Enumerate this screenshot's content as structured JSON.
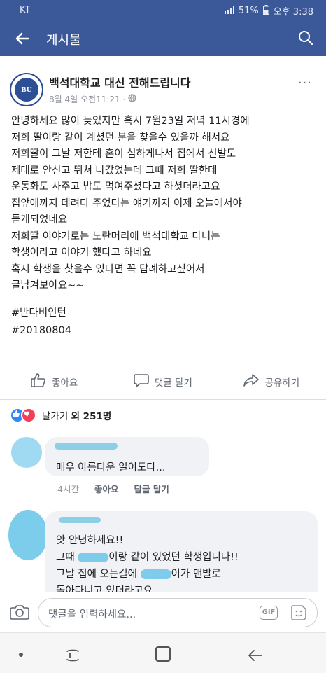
{
  "status_bar": {
    "carrier": "KT",
    "battery": "51%",
    "time": "오후 3:38"
  },
  "app_bar": {
    "title": "게시물"
  },
  "post": {
    "author": "백석대학교 대신 전해드립니다",
    "avatar_text": "BU",
    "timestamp": "8월 4일 오전11:21 ·",
    "body_lines": [
      "안녕하세요 많이 늦었지만 혹시 7월23일 저녁 11시경에",
      "저희 딸이랑 같이 계셨던 분을 찾을수 있을까 해서요",
      "저희딸이 그날 저한테 혼이 심하게나서 집에서 신발도",
      "제대로 안신고 뛰쳐 나갔었는데 그때 저희 딸한테",
      "운동화도 사주고 밥도 먹여주셨다고 하셧더라고요",
      "집앞에까지 데려다 주었다는 얘기까지 이제 오늘에서야",
      "듣게되었네요",
      "저희딸 이야기로는 노란머리에 백석대학교 다니는",
      "학생이라고 이야기 했다고 하네요",
      "혹시 학생을 찾을수 있다면 꼭 답례하고싶어서",
      "글남겨보아요~~"
    ],
    "hashtag1": "#반다비인턴",
    "hashtag2": "#20180804"
  },
  "actions": {
    "like": "좋아요",
    "comment": "댓글 달기",
    "share": "공유하기"
  },
  "reactions": {
    "prefix": "달가기",
    "count_text": "외 251명"
  },
  "comment1": {
    "text": "매우 아름다운 일이도다...",
    "time": "4시간",
    "like": "좋아요",
    "reply": "답글 달기"
  },
  "comment2": {
    "line1": "앗 안녕하세요!!",
    "line2a": "그때",
    "line2b": "이랑 같이 있었던 학생입니다!!",
    "line3a": "그날 집에 오는길에",
    "line3b": "이가 맨발로",
    "line4": "돌아다니고 있더라고요"
  },
  "composer": {
    "placeholder": "댓글을 입력하세요...",
    "gif_label": "GIF"
  },
  "colors": {
    "brand": "#3b5998",
    "like_blue": "#2d88ff",
    "love_red": "#f33e58"
  }
}
